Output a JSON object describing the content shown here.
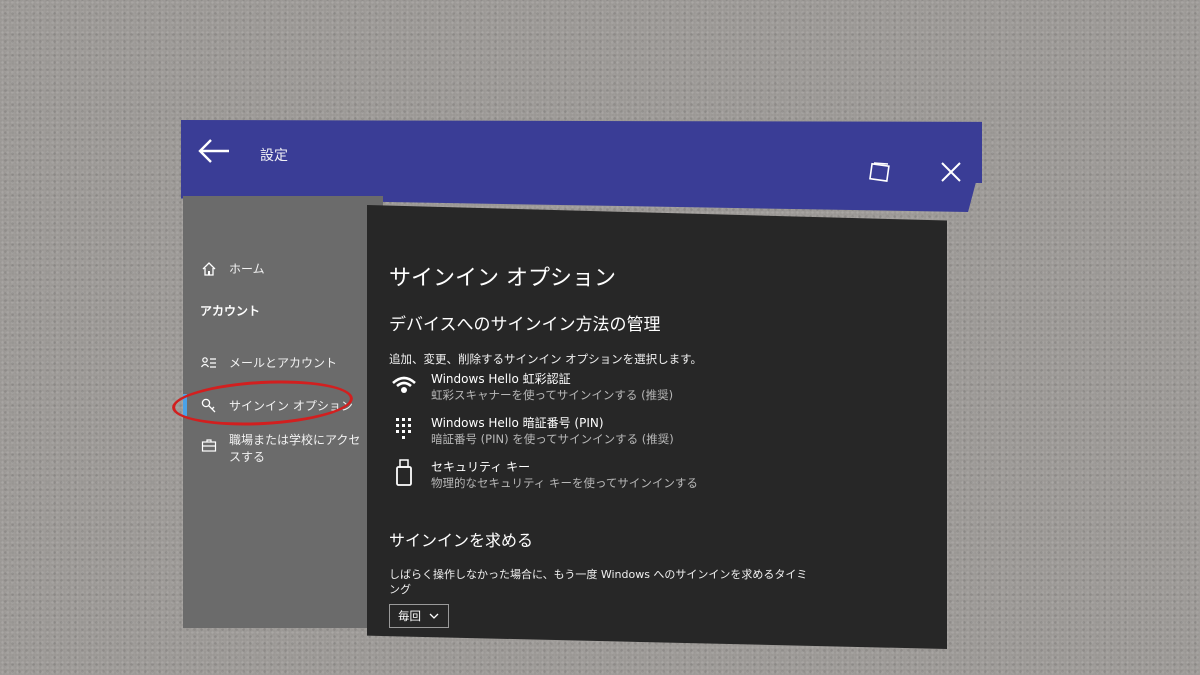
{
  "window": {
    "title": "設定",
    "accent_color": "#3a3d96",
    "icons": {
      "back": "back-arrow-icon",
      "restore": "restore-window-icon",
      "close": "close-icon"
    }
  },
  "sidebar": {
    "home_label": "ホーム",
    "section_heading": "アカウント",
    "items": [
      {
        "label": "メールとアカウント",
        "icon": "people-list-icon"
      },
      {
        "label": "サインイン オプション",
        "icon": "key-icon",
        "selected": true
      },
      {
        "label": "職場または学校にアクセスする",
        "icon": "briefcase-icon"
      }
    ],
    "selection_color": "#4aa2e8",
    "highlight_color": "#d21f1f"
  },
  "main": {
    "title": "サインイン オプション",
    "manage_heading": "デバイスへのサインイン方法の管理",
    "intro": "追加、変更、削除するサインイン オプションを選択します。",
    "options": [
      {
        "title": "Windows Hello 虹彩認証",
        "description": "虹彩スキャナーを使ってサインインする (推奨)",
        "icon": "eye-icon"
      },
      {
        "title": "Windows Hello 暗証番号 (PIN)",
        "description": "暗証番号 (PIN) を使ってサインインする (推奨)",
        "icon": "keypad-icon"
      },
      {
        "title": "セキュリティ キー",
        "description": "物理的なセキュリティ キーを使ってサインインする",
        "icon": "usb-key-icon"
      }
    ],
    "require_heading": "サインインを求める",
    "require_text": "しばらく操作しなかった場合に、もう一度 Windows へのサインインを求めるタイミング",
    "dropdown_value": "毎回"
  }
}
